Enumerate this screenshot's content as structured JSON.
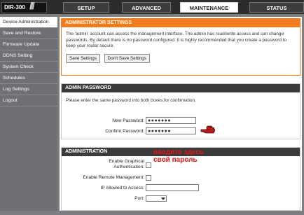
{
  "header": {
    "model": "DIR-300",
    "tabs": [
      {
        "label": "SETUP"
      },
      {
        "label": "ADVANCED"
      },
      {
        "label": "MAINTENANCE"
      },
      {
        "label": "STATUS"
      }
    ]
  },
  "sidebar": {
    "items": [
      {
        "label": "Device Administration"
      },
      {
        "label": "Save and Restore"
      },
      {
        "label": "Firmware Update"
      },
      {
        "label": "DDNS Setting"
      },
      {
        "label": "System Check"
      },
      {
        "label": "Schedules"
      },
      {
        "label": "Log Settings"
      },
      {
        "label": "Logout"
      }
    ]
  },
  "admin_settings": {
    "title": "ADMINISTRATOR SETTINGS",
    "description": "The 'admin' account can access the management interface. The admin has read/write access and can change passwords. By default there is no password configured. It is highly recommended that you create a password to keep your router secure.",
    "save_label": "Save Settings",
    "dont_save_label": "Don't Save Settings"
  },
  "admin_password": {
    "title": "ADMIN PASSWORD",
    "instruction": "Please enter the same password into both boxes,for confirmation.",
    "new_password_label": "New Password:",
    "new_password_value": "●●●●●●●",
    "confirm_password_label": "Confirm Password:",
    "confirm_password_value": "●●●●●●●"
  },
  "administration": {
    "title": "ADMINISTRATION",
    "graphical_auth_label_line1": "Enable Graphical",
    "graphical_auth_label_line2": "Authentication:",
    "remote_mgmt_label": "Enable Remote Management:",
    "ip_allowed_label": "IP Allowed to Access:",
    "port_label": "Port:"
  },
  "annotation": {
    "line1": "введите здесь",
    "line2": "свой пароль",
    "color": "#e01818"
  },
  "colors": {
    "accent": "#f07c1d",
    "header_dark": "#3a3a3a"
  }
}
